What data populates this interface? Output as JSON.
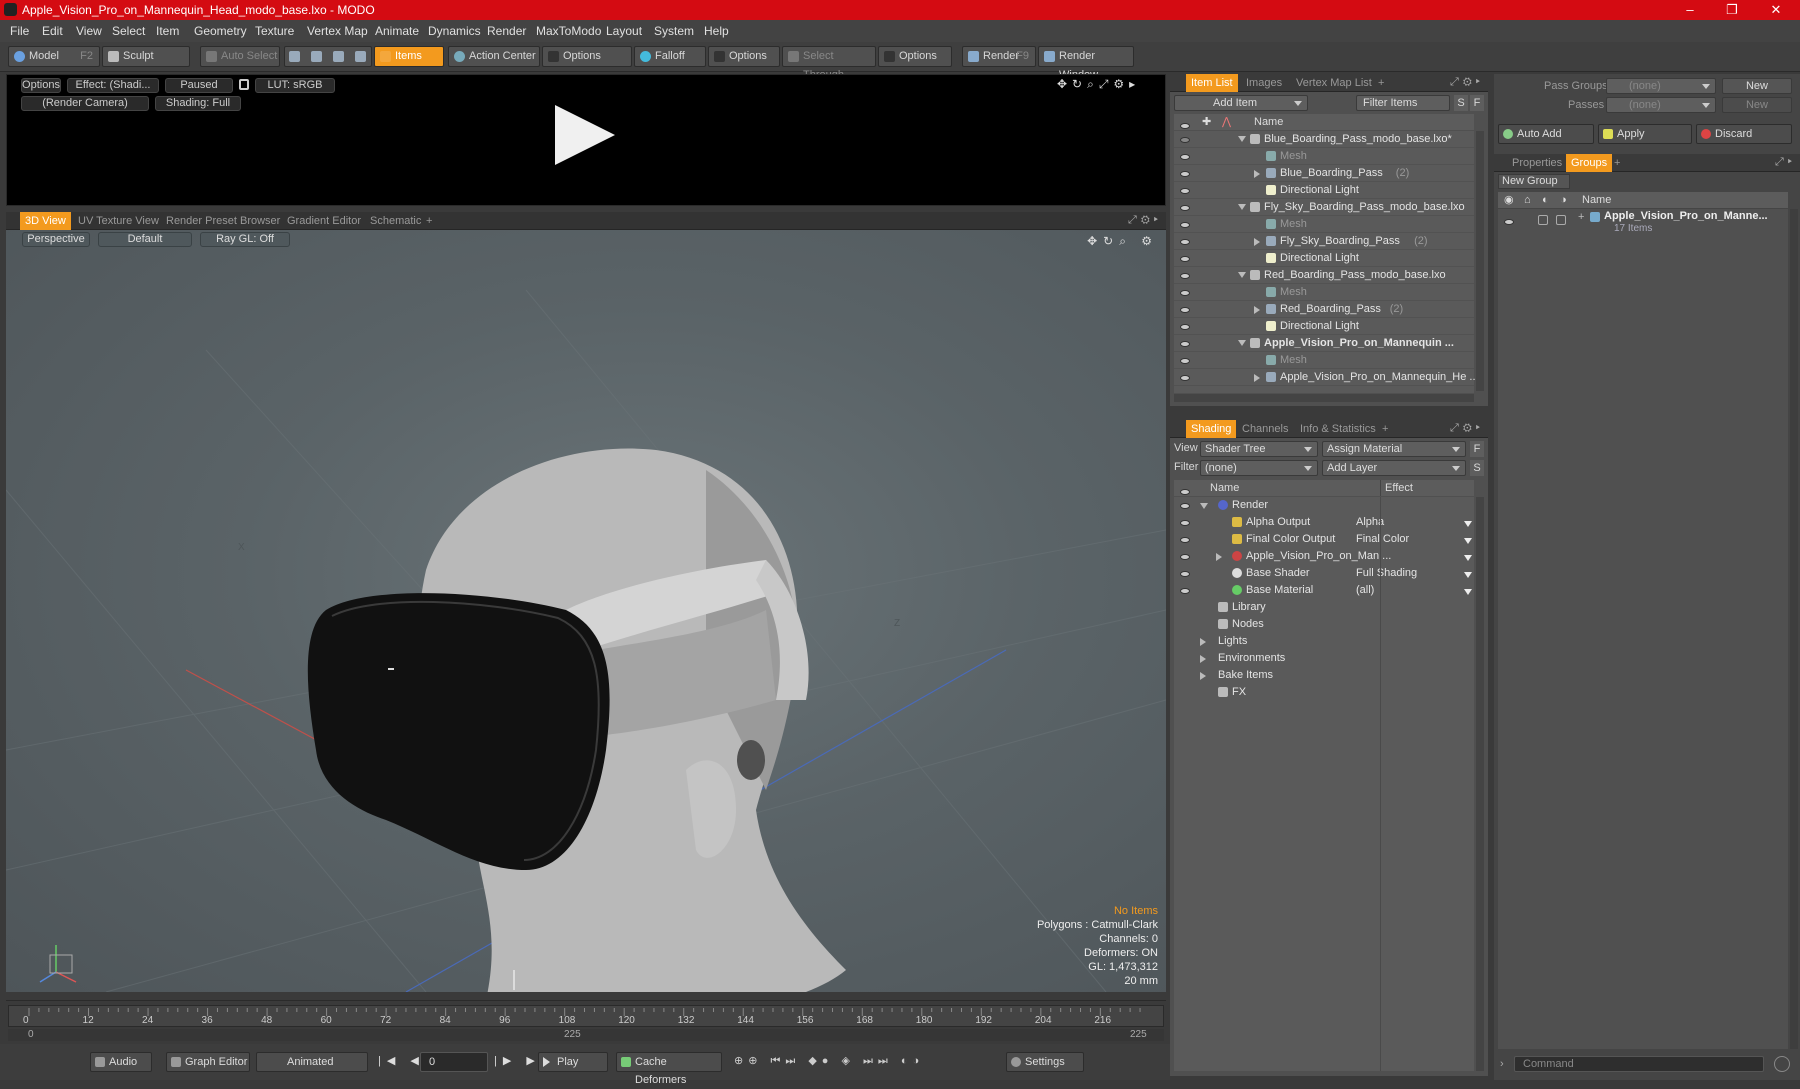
{
  "window": {
    "title": "Apple_Vision_Pro_on_Mannequin_Head_modo_base.lxo - MODO",
    "minimize": "–",
    "maximize": "❐",
    "close": "✕"
  },
  "menu": [
    "File",
    "Edit",
    "View",
    "Select",
    "Item",
    "Geometry",
    "Texture",
    "Vertex Map",
    "Animate",
    "Dynamics",
    "Render",
    "MaxToModo",
    "Layout",
    "System",
    "Help"
  ],
  "toolbar": {
    "model": "Model",
    "model_key": "F2",
    "sculpt": "Sculpt",
    "auto_select": "Auto Select",
    "items": "Items",
    "action_center": "Action Center",
    "options1": "Options",
    "falloff": "Falloff",
    "options2": "Options",
    "select_through": "Select Through",
    "options3": "Options",
    "render": "Render",
    "render_key": "F9",
    "render_window": "Render Window"
  },
  "preview": {
    "options": "Options",
    "effect": "Effect: (Shadi...",
    "paused": "Paused",
    "lut": "LUT: sRGB",
    "camera": "(Render Camera)",
    "shading": "Shading: Full"
  },
  "view_tabs": [
    "3D View",
    "UV Texture View",
    "Render Preset Browser",
    "Gradient Editor",
    "Schematic",
    "+"
  ],
  "viewport": {
    "perspective": "Perspective",
    "default": "Default",
    "raygl": "Ray GL: Off",
    "stats": {
      "items": "No Items",
      "polygons": "Polygons : Catmull-Clark",
      "channels": "Channels: 0",
      "deformers": "Deformers: ON",
      "gl": "GL: 1,473,312",
      "scale": "20 mm"
    },
    "axis_labels": {
      "x": "X",
      "z": "Z"
    }
  },
  "timeline": {
    "ticks": [
      "0",
      "12",
      "24",
      "36",
      "48",
      "60",
      "72",
      "84",
      "96",
      "108",
      "120",
      "132",
      "144",
      "156",
      "168",
      "180",
      "192",
      "204",
      "216"
    ],
    "start": "0",
    "mid": "225",
    "end": "225"
  },
  "bottombar": {
    "audio": "Audio",
    "graph_editor": "Graph Editor",
    "animated": "Animated",
    "frame": "0",
    "play": "Play",
    "cache": "Cache Deformers",
    "settings": "Settings"
  },
  "item_list": {
    "tabs": [
      "Item List",
      "Images",
      "Vertex Map List",
      "+"
    ],
    "add_item": "Add Item",
    "filter": "Filter Items",
    "s": "S",
    "f": "F",
    "col_name": "Name",
    "rows": [
      {
        "label": "Blue_Boarding_Pass_modo_base.lxo*",
        "indent": 0,
        "dim": false,
        "bold": false,
        "count": ""
      },
      {
        "label": "Mesh",
        "indent": 1,
        "dim": true,
        "bold": false,
        "count": ""
      },
      {
        "label": "Blue_Boarding_Pass",
        "indent": 1,
        "dim": false,
        "bold": false,
        "count": "(2)"
      },
      {
        "label": "Directional Light",
        "indent": 1,
        "dim": false,
        "bold": false,
        "count": ""
      },
      {
        "label": "Fly_Sky_Boarding_Pass_modo_base.lxo",
        "indent": 0,
        "dim": false,
        "bold": false,
        "count": ""
      },
      {
        "label": "Mesh",
        "indent": 1,
        "dim": true,
        "bold": false,
        "count": ""
      },
      {
        "label": "Fly_Sky_Boarding_Pass",
        "indent": 1,
        "dim": false,
        "bold": false,
        "count": "(2)"
      },
      {
        "label": "Directional Light",
        "indent": 1,
        "dim": false,
        "bold": false,
        "count": ""
      },
      {
        "label": "Red_Boarding_Pass_modo_base.lxo",
        "indent": 0,
        "dim": false,
        "bold": false,
        "count": ""
      },
      {
        "label": "Mesh",
        "indent": 1,
        "dim": true,
        "bold": false,
        "count": ""
      },
      {
        "label": "Red_Boarding_Pass",
        "indent": 1,
        "dim": false,
        "bold": false,
        "count": "(2)"
      },
      {
        "label": "Directional Light",
        "indent": 1,
        "dim": false,
        "bold": false,
        "count": ""
      },
      {
        "label": "Apple_Vision_Pro_on_Mannequin ...",
        "indent": 0,
        "dim": false,
        "bold": true,
        "count": ""
      },
      {
        "label": "Mesh",
        "indent": 1,
        "dim": true,
        "bold": false,
        "count": ""
      },
      {
        "label": "Apple_Vision_Pro_on_Mannequin_He ...",
        "indent": 1,
        "dim": false,
        "bold": false,
        "count": ""
      }
    ]
  },
  "shading": {
    "tabs": [
      "Shading",
      "Channels",
      "Info & Statistics",
      "+"
    ],
    "view_label": "View",
    "view_value": "Shader Tree",
    "assign": "Assign Material",
    "filter_label": "Filter",
    "filter_value": "(none)",
    "add_layer": "Add Layer",
    "col_name": "Name",
    "col_effect": "Effect",
    "rows": [
      {
        "label": "Render",
        "effect": "",
        "indent": 0
      },
      {
        "label": "Alpha Output",
        "effect": "Alpha",
        "indent": 1
      },
      {
        "label": "Final Color Output",
        "effect": "Final Color",
        "indent": 1
      },
      {
        "label": "Apple_Vision_Pro_on_Man ...",
        "effect": "",
        "indent": 1
      },
      {
        "label": "Base Shader",
        "effect": "Full Shading",
        "indent": 1
      },
      {
        "label": "Base Material",
        "effect": "(all)",
        "indent": 1
      },
      {
        "label": "Library",
        "effect": "",
        "indent": 0
      },
      {
        "label": "Nodes",
        "effect": "",
        "indent": 0
      },
      {
        "label": "Lights",
        "effect": "",
        "indent": -1
      },
      {
        "label": "Environments",
        "effect": "",
        "indent": -1
      },
      {
        "label": "Bake Items",
        "effect": "",
        "indent": -1
      },
      {
        "label": "FX",
        "effect": "",
        "indent": 0
      }
    ]
  },
  "groups": {
    "pass_groups": "Pass Groups",
    "pass_groups_val": "(none)",
    "new": "New",
    "passes": "Passes",
    "passes_val": "(none)",
    "new2": "New",
    "auto_add": "Auto Add",
    "apply": "Apply",
    "discard": "Discard",
    "tabs": [
      "Properties",
      "Groups",
      "+"
    ],
    "new_group": "New Group",
    "col_name": "Name",
    "item": "Apple_Vision_Pro_on_Manne...",
    "item_count": "17 Items",
    "command": "Command"
  },
  "colors": {
    "accent": "#f39a1e",
    "titlebar": "#d40b12"
  }
}
